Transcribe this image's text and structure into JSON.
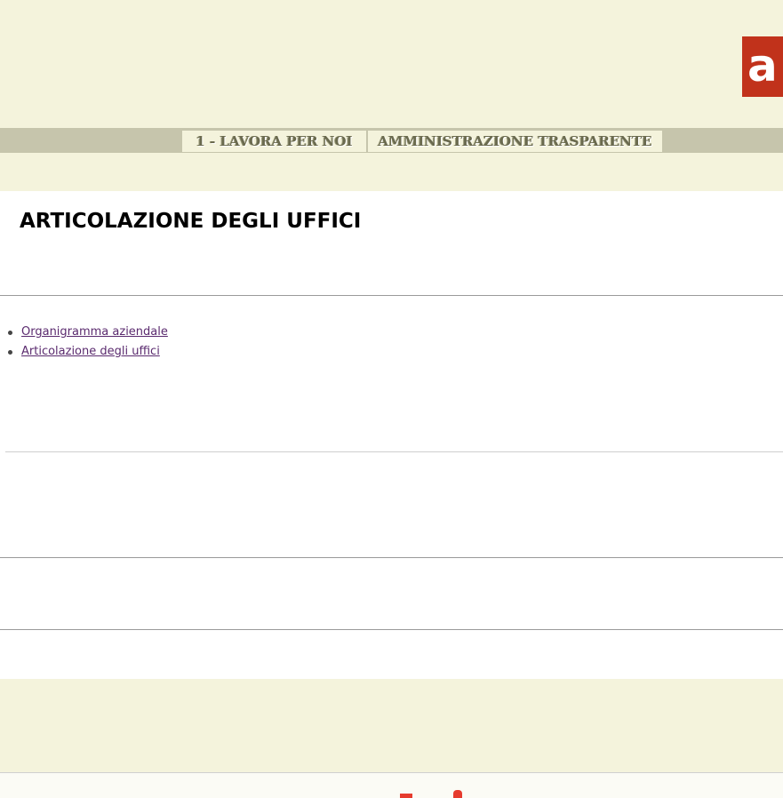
{
  "header": {
    "logo_text": "a",
    "nav": [
      {
        "label": "1 - LAVORA PER NOI"
      },
      {
        "label": "AMMINISTRAZIONE TRASPARENTE"
      }
    ]
  },
  "main": {
    "title": "ARTICOLAZIONE DEGLI UFFICI",
    "links": [
      {
        "label": "Organigramma aziendale"
      },
      {
        "label": "Articolazione degli uffici"
      }
    ]
  },
  "colors": {
    "band_bg": "#f4f3dc",
    "nav_bar": "#c6c5ac",
    "logo_red": "#c1321b",
    "link": "#5a2a6e"
  }
}
